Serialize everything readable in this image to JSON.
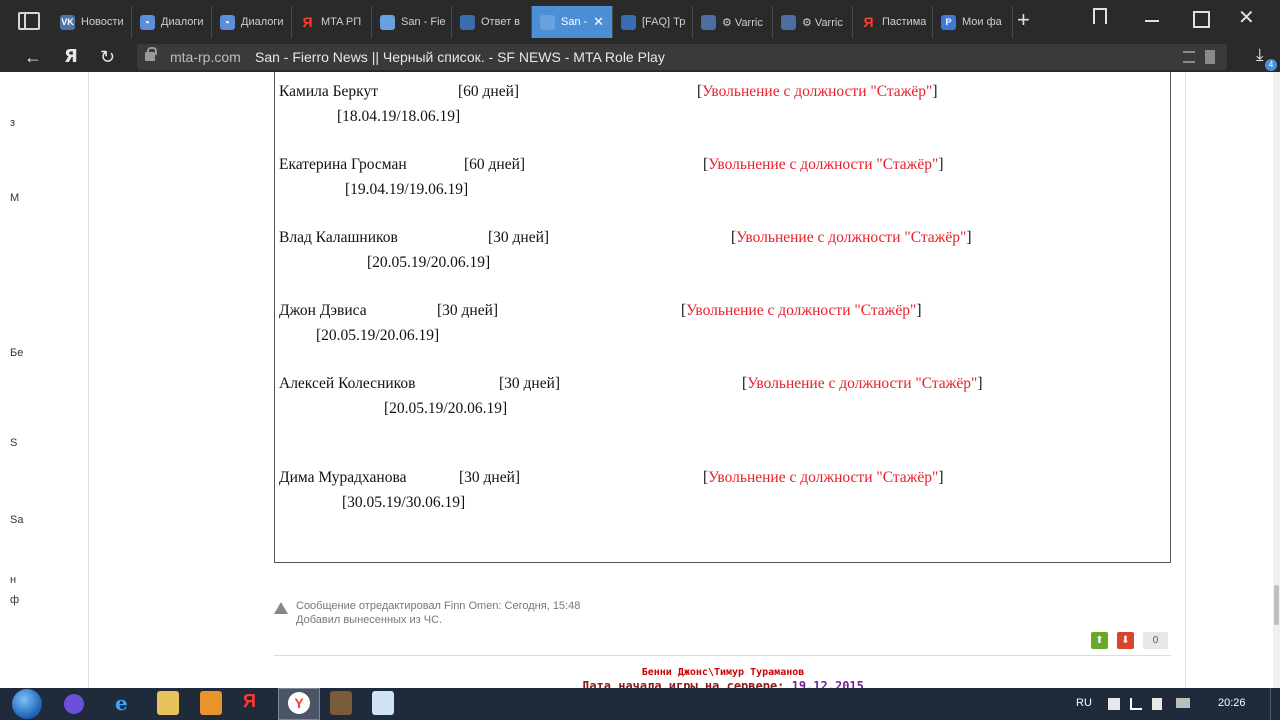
{
  "browser": {
    "tabs": [
      {
        "label": "Новости",
        "icon": "vk-icon",
        "fav_class": "vk",
        "fav_text": "VK",
        "active": false
      },
      {
        "label": "Диалоги",
        "icon": "chat-icon",
        "fav_class": "chat",
        "fav_text": "▪",
        "active": false
      },
      {
        "label": "Диалоги",
        "icon": "chat-icon",
        "fav_class": "chat",
        "fav_text": "▪",
        "active": false
      },
      {
        "label": "MTA РП",
        "icon": "yandex-icon",
        "fav_class": "ya",
        "fav_text": "Я",
        "active": false
      },
      {
        "label": "San - Fie",
        "icon": "site-icon",
        "fav_class": "san",
        "fav_text": "",
        "active": false
      },
      {
        "label": "Ответ в",
        "icon": "site-icon",
        "fav_class": "faq",
        "fav_text": "",
        "active": false
      },
      {
        "label": "San -",
        "icon": "site-icon",
        "fav_class": "san",
        "fav_text": "",
        "active": true,
        "close": "✕"
      },
      {
        "label": "[FAQ] Тр",
        "icon": "site-icon",
        "fav_class": "faq",
        "fav_text": "",
        "active": false
      },
      {
        "label": "⚙ Varric",
        "icon": "site-icon",
        "fav_class": "chk",
        "fav_text": "",
        "active": false
      },
      {
        "label": "⚙ Varric",
        "icon": "site-icon",
        "fav_class": "chk",
        "fav_text": "",
        "active": false
      },
      {
        "label": "Пастима",
        "icon": "yandex-icon",
        "fav_class": "ya",
        "fav_text": "Я",
        "active": false
      },
      {
        "label": "Мои фа",
        "icon": "p-icon",
        "fav_class": "p",
        "fav_text": "P",
        "active": false
      }
    ],
    "new_tab": "+",
    "url_domain": "mta-rp.com",
    "page_title": "San - Fierro News || Черный список. - SF NEWS - MTA Role Play",
    "yandex_logo": "Я",
    "download_count": "4"
  },
  "blacklist": [
    {
      "name": "Камила Беркут",
      "duration": "[60 дней]",
      "reason": "Увольнение с должности \"Стажёр\"",
      "dates": "[18.04.19/18.06.19]"
    },
    {
      "name": "Екатерина Гросман",
      "duration": "[60 дней]",
      "reason": "Увольнение с должности \"Стажёр\"",
      "dates": "[19.04.19/19.06.19]"
    },
    {
      "name": "Влад Калашников",
      "duration": "[30 дней]",
      "reason": "Увольнение с должности \"Стажёр\"",
      "dates": "[20.05.19/20.06.19]"
    },
    {
      "name": "Джон Дэвиса",
      "duration": "[30 дней]",
      "reason": "Увольнение с должности \"Стажёр\"",
      "dates": "[20.05.19/20.06.19]"
    },
    {
      "name": "Алексей Колесников",
      "duration": "[30 дней]",
      "reason": "Увольнение с должности \"Стажёр\"",
      "dates": "[20.05.19/20.06.19]"
    },
    {
      "name": "Дима Мурадханова",
      "duration": "[30 дней]",
      "reason": "Увольнение с должности \"Стажёр\"",
      "dates": "[30.05.19/30.06.19]"
    }
  ],
  "edit_note": {
    "line1": "Сообщение отредактировал Finn Omen: Сегодня, 15:48",
    "line2": "Добавил вынесенных из ЧС."
  },
  "votes": {
    "up": "⬆",
    "down": "⬇",
    "count": "0"
  },
  "signature": {
    "name": "Бенни Джонс\\Тимур Тураманов",
    "date_label": "Дата начала игры на сервере: ",
    "date_value": "19.12.2015"
  },
  "left_cutoff_letters": [
    "з",
    "М",
    "Бе",
    "S",
    "Sa",
    "н",
    "ф"
  ],
  "taskbar": {
    "lang": "RU",
    "clock": "20:26"
  }
}
